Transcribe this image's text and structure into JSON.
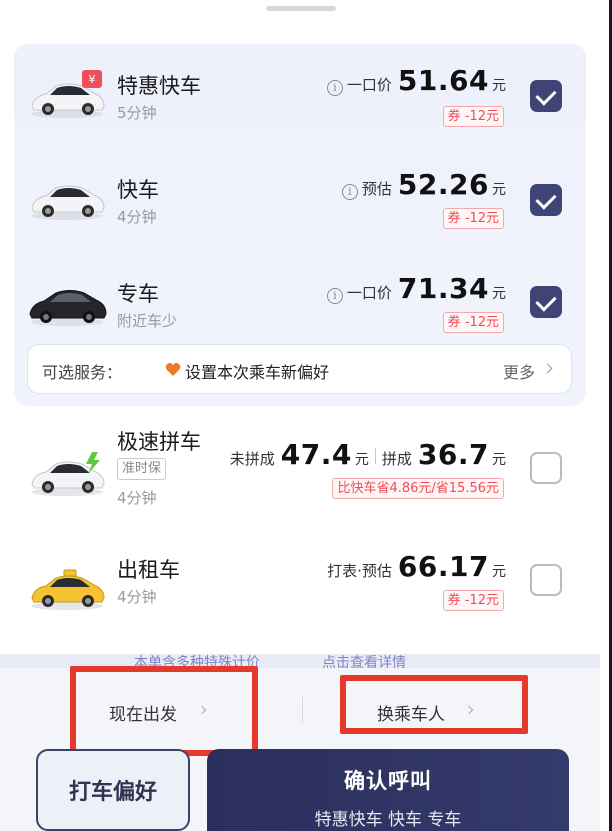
{
  "options": [
    {
      "name": "特惠快车",
      "sub": "5分钟",
      "price_label": "一口价",
      "price": "51.64",
      "unit": "元",
      "coupon": "券 -12元",
      "checked": true
    },
    {
      "name": "快车",
      "sub": "4分钟",
      "price_label": "预估",
      "price": "52.26",
      "unit": "元",
      "coupon": "券 -12元",
      "checked": true
    },
    {
      "name": "专车",
      "sub": "附近车少",
      "price_label": "一口价",
      "price": "71.34",
      "unit": "元",
      "coupon": "券 -12元",
      "checked": true
    },
    {
      "name": "极速拼车",
      "tag": "准时保",
      "sub": "4分钟",
      "unpooled_label": "未拼成",
      "unpooled_price": "47.4",
      "pooled_label": "拼成",
      "pooled_price": "36.7",
      "unit": "元",
      "savings": "比快车省4.86元/省15.56元",
      "checked": false
    },
    {
      "name": "出租车",
      "sub": "4分钟",
      "price_label": "打表·预估",
      "price": "66.17",
      "unit": "元",
      "coupon": "券 -12元",
      "checked": false
    }
  ],
  "services": {
    "label": "可选服务：",
    "preference": "设置本次乘车新偏好",
    "more": "更多"
  },
  "info_strip": {
    "left": "本单含多种特殊计价",
    "right": "点击查看详情"
  },
  "bottom": {
    "depart": "现在出发",
    "change_passenger": "换乘车人",
    "preference_button": "打车偏好",
    "confirm_button": "确认呼叫",
    "confirm_sub": "特惠快车 快车 专车"
  },
  "colors": {
    "accent": "#3e4576",
    "coupon_red": "#f04b55",
    "highlight_box": "#e5392e",
    "taxi_yellow": "#f5c231"
  }
}
